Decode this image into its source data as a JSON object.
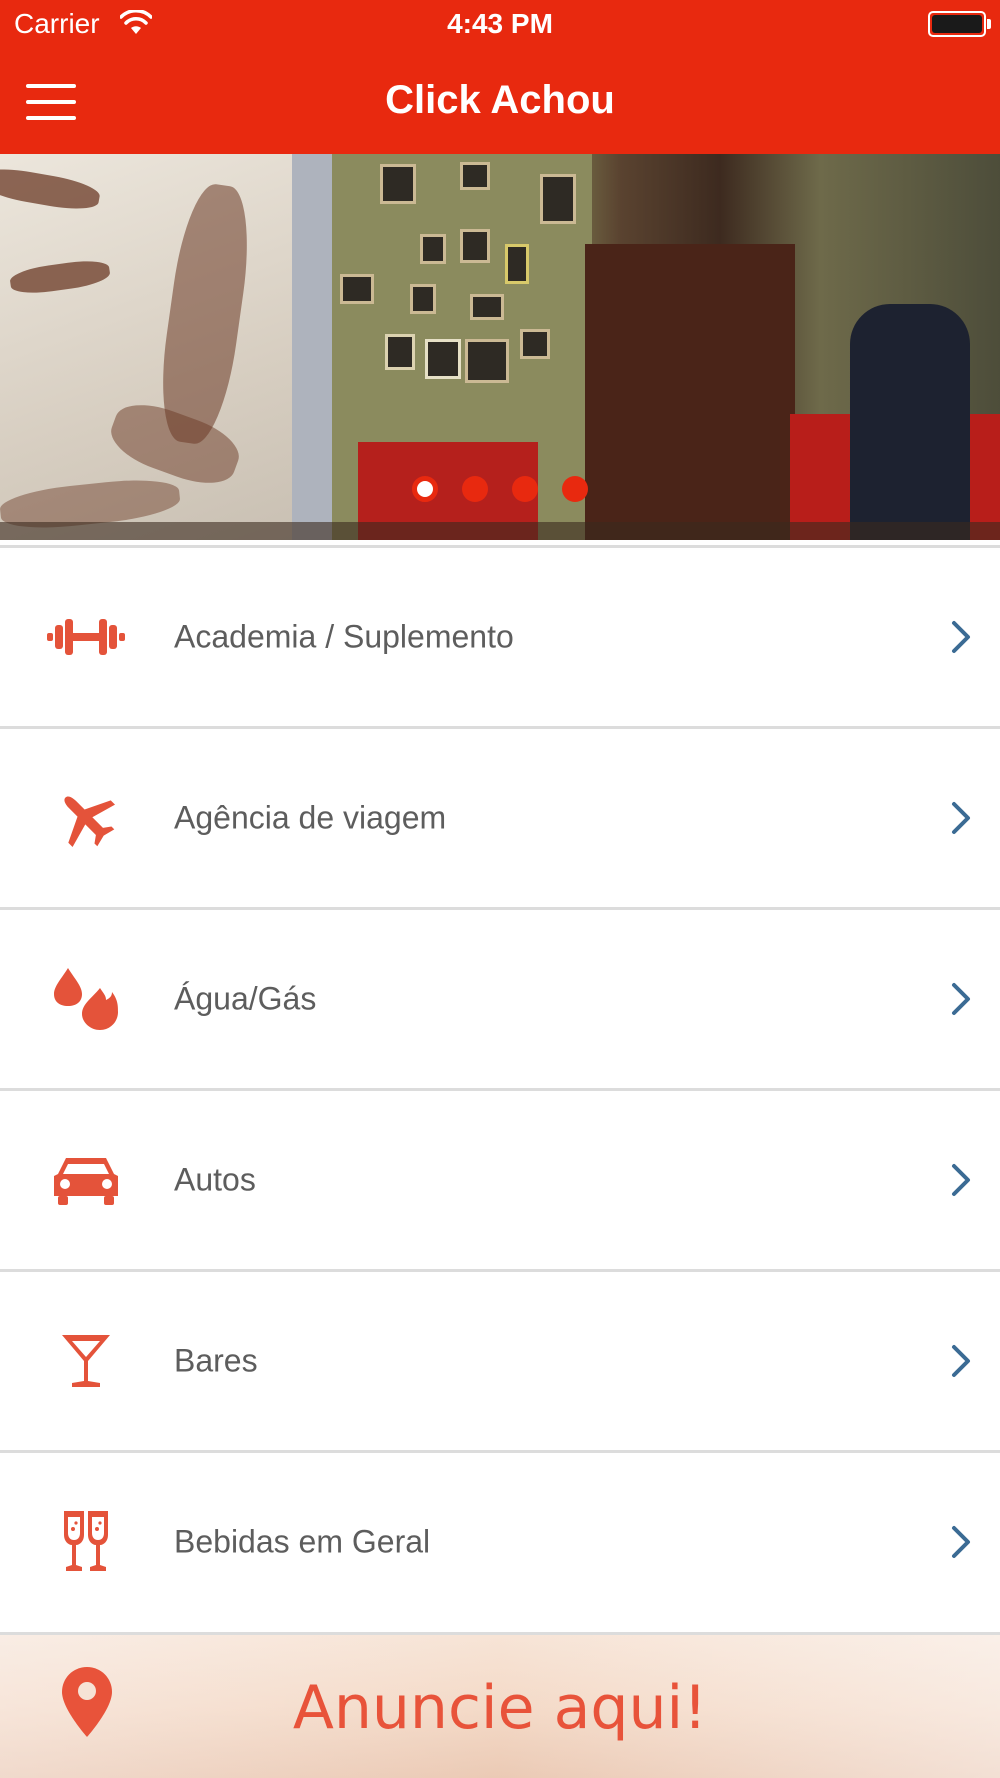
{
  "status_bar": {
    "carrier": "Carrier",
    "time": "4:43 PM"
  },
  "nav_bar": {
    "title": "Click Achou"
  },
  "carousel": {
    "page_count": 4,
    "active_index": 0
  },
  "categories": [
    {
      "label": "Academia / Suplemento",
      "icon": "dumbbell-icon"
    },
    {
      "label": "Agência de viagem",
      "icon": "airplane-icon"
    },
    {
      "label": "Água/Gás",
      "icon": "water-fire-icon"
    },
    {
      "label": "Autos",
      "icon": "car-icon"
    },
    {
      "label": "Bares",
      "icon": "cocktail-icon"
    },
    {
      "label": "Bebidas em Geral",
      "icon": "champagne-glasses-icon"
    }
  ],
  "ad": {
    "text": "Anuncie aqui!"
  },
  "colors": {
    "brand": "#e8290f",
    "icon": "#e4533a",
    "chevron": "#3b6b94",
    "label": "#5d5d5d"
  }
}
